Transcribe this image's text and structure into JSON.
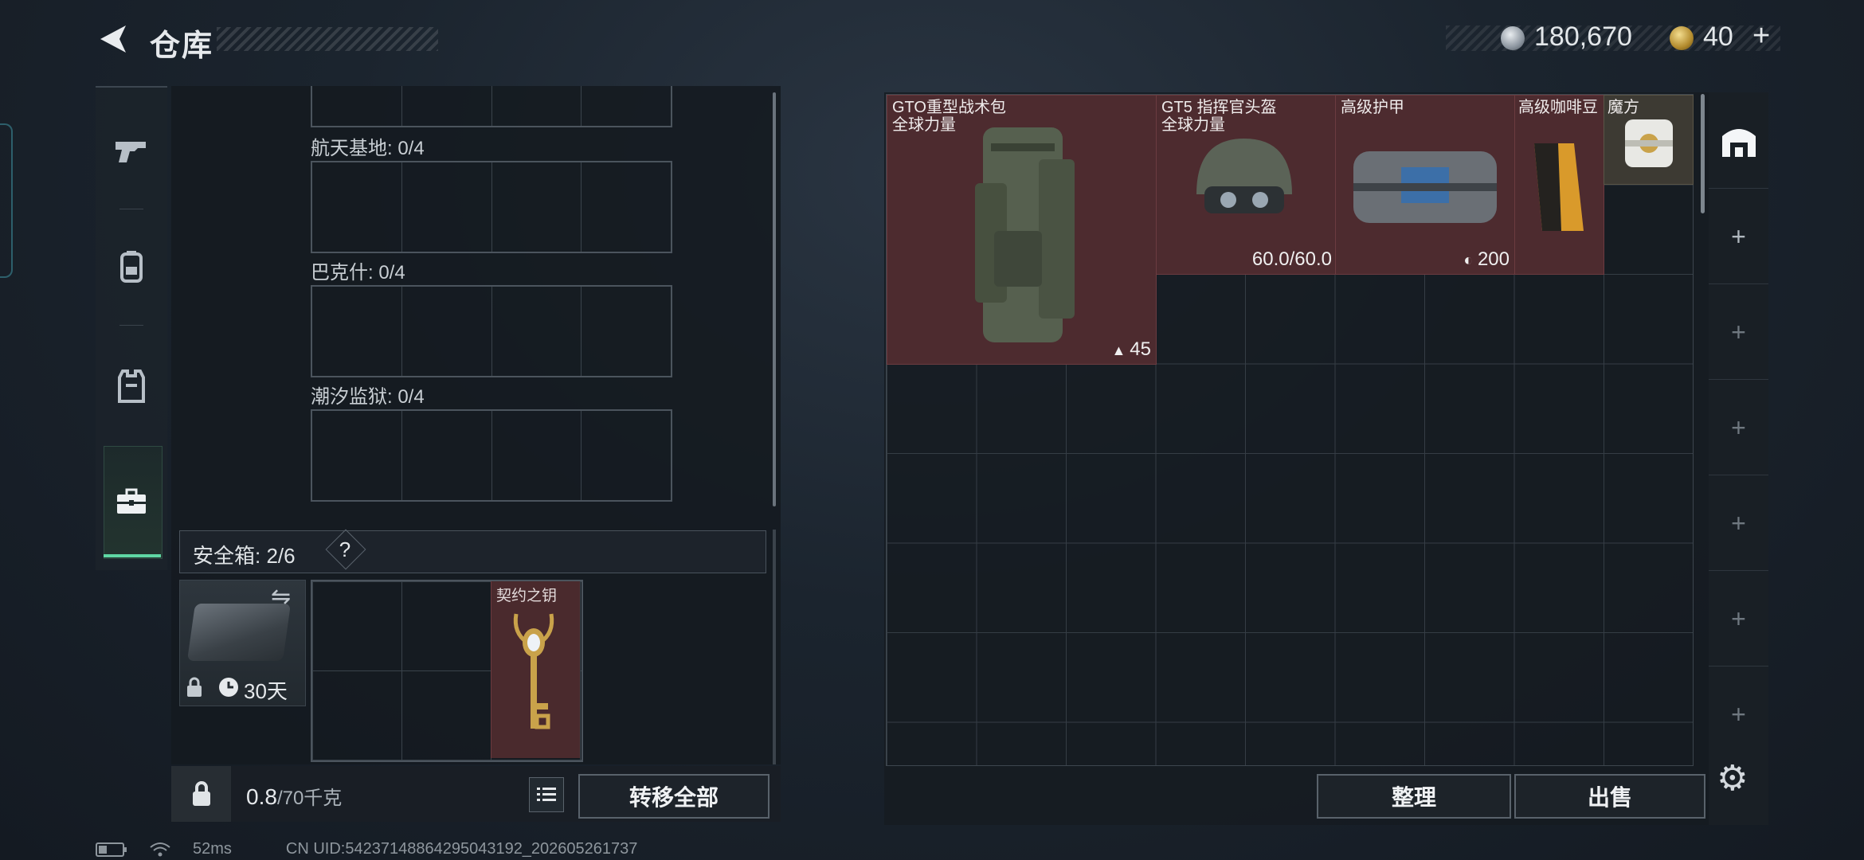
{
  "header": {
    "title": "仓库",
    "currency_primary": "180,670",
    "currency_secondary": "40",
    "add_label": "+"
  },
  "left": {
    "categories": [
      "pistol-icon",
      "backpack-icon",
      "vest-icon",
      "case-icon"
    ],
    "containers": [
      {
        "label": "航天基地: 0/4"
      },
      {
        "label": "巴克什: 0/4"
      },
      {
        "label": "潮汐监狱: 0/4"
      }
    ],
    "secure_box": {
      "label": "安全箱: 2/6",
      "help": "?",
      "duration": "30天",
      "key_item": "契约之钥"
    },
    "weight_current": "0.8",
    "weight_max": "/70千克",
    "transfer_all": "转移全部"
  },
  "stash": {
    "items": [
      {
        "name_line1": "GTO重型战术包",
        "name_line2": "全球力量",
        "stat": "45"
      },
      {
        "name_line1": "GT5 指挥官头盔",
        "name_line2": "全球力量",
        "stat": "60.0/60.0"
      },
      {
        "name_line1": "高级护甲",
        "stat": "200"
      },
      {
        "name_line1": "高级咖啡豆"
      },
      {
        "name_line1": "魔方"
      }
    ],
    "tab_plus": "+",
    "sort": "整理",
    "sell": "出售"
  },
  "status": {
    "ping": "52ms",
    "uid": "CN UID:54237148864295043192_202605261737"
  },
  "colors": {
    "accent_green": "#5fd7a4",
    "item_bg": "#4d2b2f"
  }
}
